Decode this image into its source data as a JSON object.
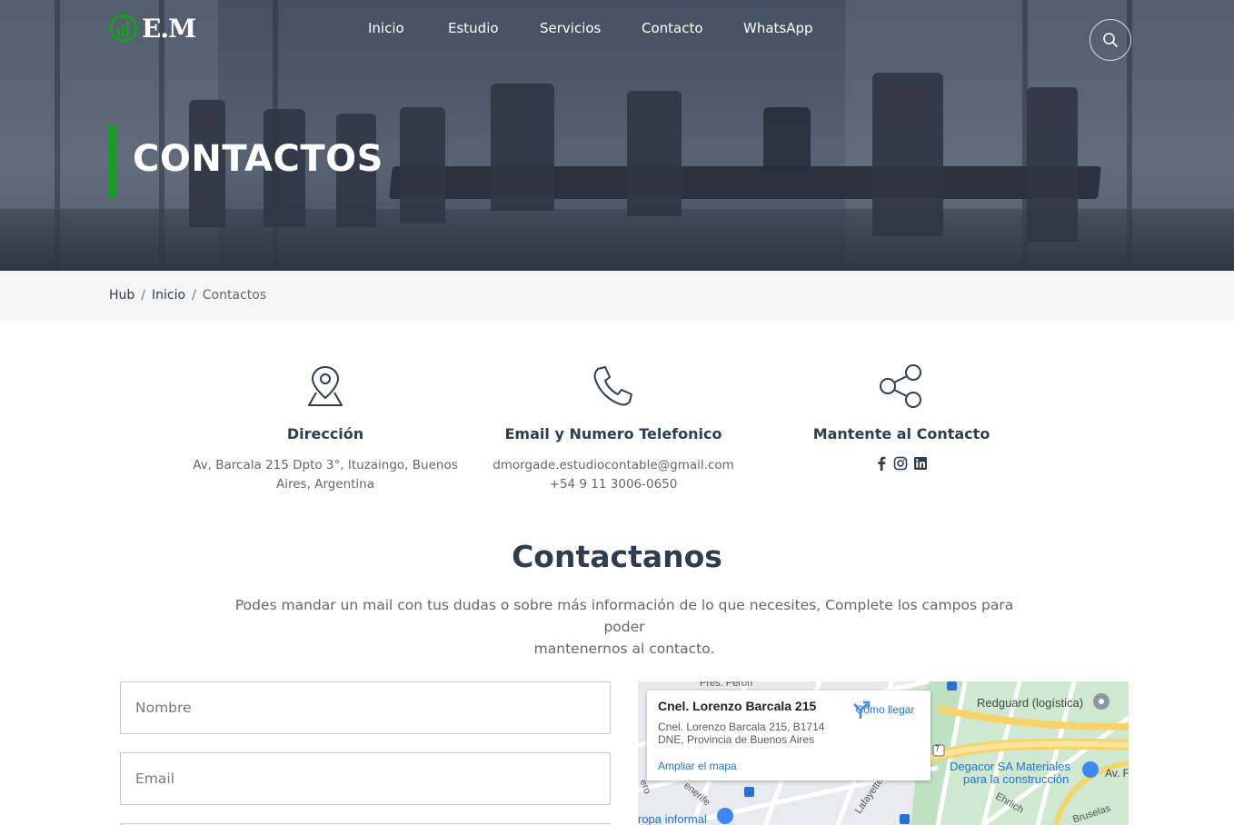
{
  "brand": {
    "logo_text": "E.M",
    "accent": "#12a21b"
  },
  "nav": {
    "items": [
      "Inicio",
      "Estudio",
      "Servicios",
      "Contacto",
      "WhatsApp"
    ],
    "search_icon": "search-icon"
  },
  "hero": {
    "title": "CONTACTOS"
  },
  "breadcrumb": {
    "items": [
      "Hub",
      "Inicio"
    ],
    "current": "Contactos",
    "separator": "/"
  },
  "info": [
    {
      "icon": "map-pin-icon",
      "title": "Dirección",
      "lines": [
        "Av, Barcala 215 Dpto 3°, Ituzaingo, Buenos",
        "Aires, Argentina"
      ]
    },
    {
      "icon": "phone-icon",
      "title": "Email y Numero Telefonico",
      "lines": [
        "dmorgade.estudiocontable@gmail.com",
        "+54 9 11 3006-0650"
      ]
    },
    {
      "icon": "share-icon",
      "title": "Mantente al Contacto",
      "social": [
        "facebook-icon",
        "instagram-icon",
        "linkedin-icon"
      ]
    }
  ],
  "contact": {
    "heading": "Contactanos",
    "text_line1": "Podes mandar un mail con tus dudas o sobre más información de lo que necesites, Complete los campos para poder",
    "text_line2": "mantenernos al contacto."
  },
  "form": {
    "name_placeholder": "Nombre",
    "email_placeholder": "Email"
  },
  "map": {
    "place_title": "Cnel. Lorenzo Barcala 215",
    "address_line1": "Cnel. Lorenzo Barcala 215, B1714",
    "address_line2": "DNE, Provincia de Buenos Aires",
    "directions_label": "Cómo llegar",
    "expand_label": "Ampliar el mapa",
    "labels": {
      "redguard": "Redguard (logística)",
      "degacor_1": "Degacor SA Materiales",
      "degacor_2": "para la construcción",
      "lafayette": "Lafayette",
      "ehrlich": "Ehrlich",
      "bruselas": "Bruselas",
      "tenerife": "enerife",
      "informal": "ropa informal",
      "peron": "Pres. Perón",
      "avf": "Av. F",
      "pero": "ero",
      "route": "7"
    }
  }
}
